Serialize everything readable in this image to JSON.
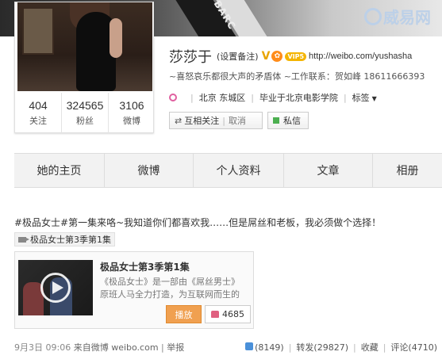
{
  "banner": {
    "text": "BARC",
    "watermark": "威易网"
  },
  "profile": {
    "name": "莎莎于",
    "remark": "(设置备注)",
    "v_badge": "V",
    "vip_badge": "VIP5",
    "url": "http://weibo.com/yushasha",
    "bio": "~喜怒哀乐都很大声的矛盾体 ~工作联系：贺如峰 18611666393",
    "location": "北京 东城区",
    "school": "毕业于北京电影学院",
    "tags_label": "标签",
    "stats": [
      {
        "num": "404",
        "label": "关注"
      },
      {
        "num": "324565",
        "label": "粉丝"
      },
      {
        "num": "3106",
        "label": "微博"
      }
    ]
  },
  "buttons": {
    "follow": "互相关注",
    "cancel": "取消",
    "message": "私信"
  },
  "tabs": [
    "她的主页",
    "微博",
    "个人资料",
    "文章",
    "相册"
  ],
  "post": {
    "text": "#极品女士#第一集来咯~我知道你们都喜欢我……但是屌丝和老板，我必须做个选择！",
    "video_tag": "极品女士第3季第1集",
    "video_title": "极品女士第3季第1集",
    "video_desc_line1": "《极品女士》是一部由《屌丝男士》",
    "video_desc_line2": "原班人马全力打造，为互联网而生的",
    "play_label": "播放",
    "like_count": "4685",
    "time": "9月3日 09:06",
    "source": "来自微博 weibo.com",
    "report": "举报",
    "likes": "(8149)",
    "repost": "转发(29827)",
    "favorite": "收藏",
    "comment": "评论(4710)"
  }
}
